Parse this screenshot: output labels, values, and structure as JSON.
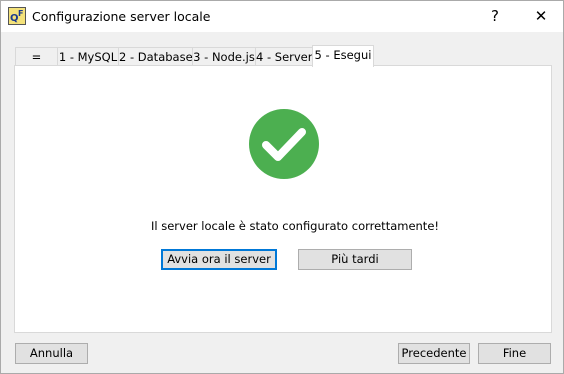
{
  "window": {
    "title": "Configurazione server locale",
    "help_label": "?",
    "close_label": "✕"
  },
  "tabs": [
    {
      "label": "="
    },
    {
      "label": "1 - MySQL"
    },
    {
      "label": "2 - Database"
    },
    {
      "label": "3 - Node.js"
    },
    {
      "label": "4 - Server"
    },
    {
      "label": "5 - Esegui",
      "active": true
    }
  ],
  "content": {
    "status_icon": "check-circle-icon",
    "status_color": "#4caf50",
    "message": "Il server locale è stato configurato correttamente!",
    "start_now_label": "Avvia ora il server",
    "later_label": "Più tardi"
  },
  "footer": {
    "cancel_label": "Annulla",
    "previous_label": "Precedente",
    "finish_label": "Fine"
  }
}
